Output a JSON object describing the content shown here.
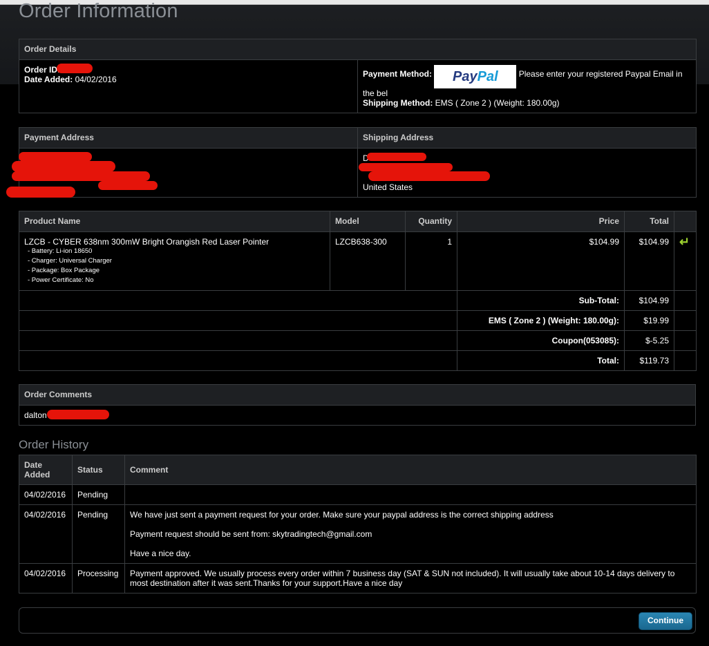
{
  "page": {
    "title": "Order Information"
  },
  "order_details": {
    "header": "Order Details",
    "order_id_label": "Order ID:",
    "date_added_label": "Date Added:",
    "date_added": "04/02/2016",
    "payment_method_label": "Payment Method:",
    "payment_logo_left": "Pay",
    "payment_logo_right": "Pal",
    "payment_method_text": "Please enter your registered Paypal Email in the bel",
    "shipping_method_label": "Shipping Method:",
    "shipping_method": "EMS ( Zone 2 ) (Weight: 180.00g)"
  },
  "addresses": {
    "payment_header": "Payment Address",
    "shipping_header": "Shipping Address",
    "shipping_initial": "D",
    "shipping_country": "United States"
  },
  "products": {
    "headers": {
      "name": "Product Name",
      "model": "Model",
      "quantity": "Quantity",
      "price": "Price",
      "total": "Total"
    },
    "items": [
      {
        "name": "LZCB - CYBER 638nm 300mW Bright Orangish Red Laser Pointer",
        "options": [
          "- Battery: Li-ion 18650",
          "- Charger: Universal Charger",
          "- Package: Box Package",
          "- Power Certificate: No"
        ],
        "model": "LZCB638-300",
        "quantity": "1",
        "price": "$104.99",
        "total": "$104.99",
        "reorder_icon": "reorder-arrow-icon"
      }
    ],
    "totals": [
      {
        "label": "Sub-Total:",
        "value": "$104.99"
      },
      {
        "label": "EMS ( Zone 2 ) (Weight: 180.00g):",
        "value": "$19.99"
      },
      {
        "label": "Coupon(053085):",
        "value": "$-5.25"
      },
      {
        "label": "Total:",
        "value": "$119.73"
      }
    ]
  },
  "comments": {
    "header": "Order Comments",
    "text": "dalton"
  },
  "history": {
    "title": "Order History",
    "headers": {
      "date": "Date Added",
      "status": "Status",
      "comment": "Comment"
    },
    "rows": [
      {
        "date": "04/02/2016",
        "status": "Pending",
        "comment": [
          ""
        ]
      },
      {
        "date": "04/02/2016",
        "status": "Pending",
        "comment": [
          "We have just sent a payment request for your order. Make sure your paypal address is the correct shipping address",
          "Payment request should be sent from: skytradingtech@gmail.com",
          "Have a nice day."
        ]
      },
      {
        "date": "04/02/2016",
        "status": "Processing",
        "comment": [
          "Payment approved. We usually process every order within 7 business day (SAT & SUN not included). It will usually take about 10-14 days delivery to most destination after it was sent.Thanks for your support.Have a nice day"
        ]
      }
    ]
  },
  "actions": {
    "continue": "Continue"
  },
  "colors": {
    "accent_button": "#1f77a3",
    "reorder_icon": "#9cd12f",
    "redaction": "#e5140a"
  }
}
